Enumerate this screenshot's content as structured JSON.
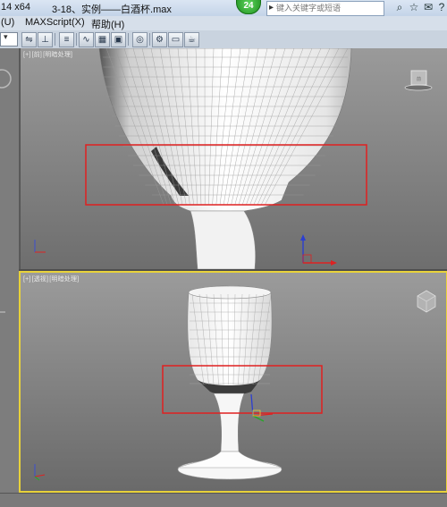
{
  "title_bar": {
    "left_text": "14 x64",
    "document_title": "3-18、实例——白酒杯.max",
    "badge": "24",
    "search_placeholder": "键入关键字或短语"
  },
  "menu": {
    "items": [
      "(U)",
      "MAXScript(X)",
      "帮助(H)"
    ]
  },
  "toolbar": {
    "icons": [
      "mirror-icon",
      "align-icon",
      "layer-manager-icon",
      "curve-editor-icon",
      "schematic-view-icon",
      "material-editor-icon",
      "render-setup-icon",
      "rendered-frame-icon",
      "render-icon",
      "teapot-icon"
    ]
  },
  "viewports": {
    "top": {
      "label_plus": "[+]",
      "label_view": "[前]",
      "label_shading": "[明暗处理]",
      "highlight_color": "#e02020"
    },
    "bottom": {
      "label_plus": "[+]",
      "label_view": "[透视]",
      "label_shading": "[明暗处理]",
      "active_border_color": "#e8d23a",
      "highlight_color": "#e02020"
    }
  },
  "colors": {
    "axis_x": "#d22",
    "axis_y": "#2a2",
    "axis_z": "#23c"
  }
}
